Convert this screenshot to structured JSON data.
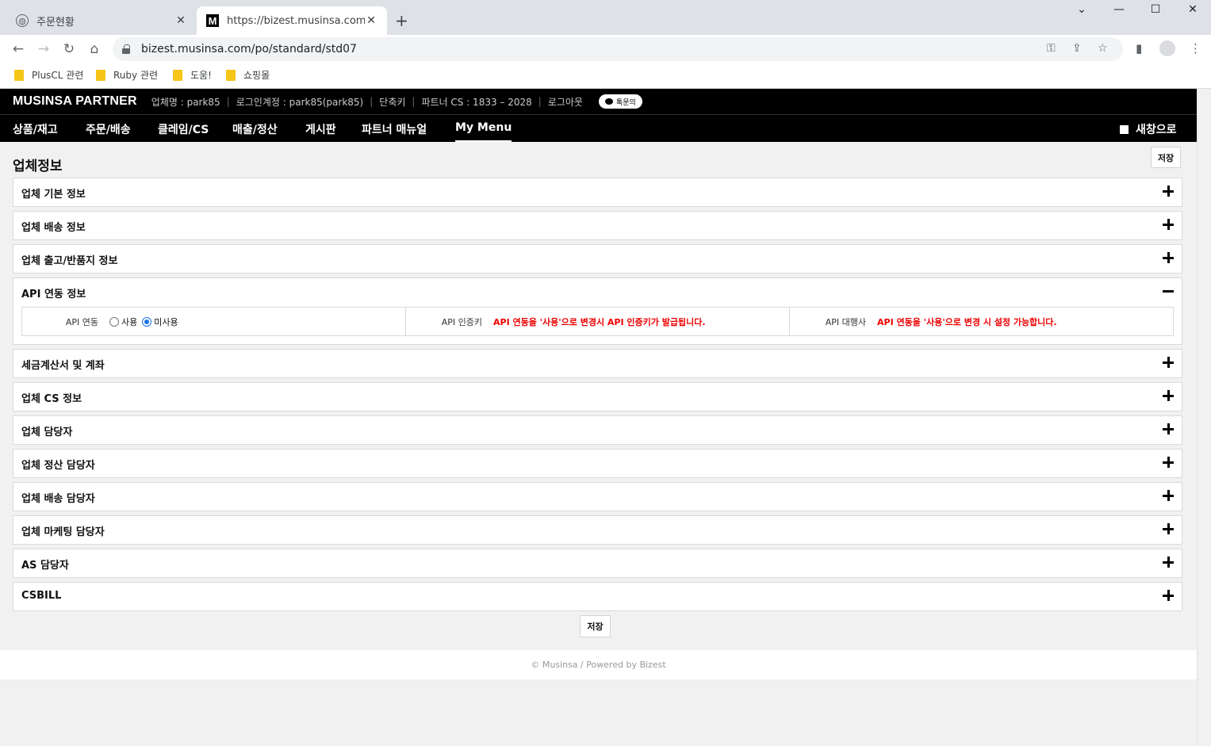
{
  "browser": {
    "tabs": [
      {
        "title": "주문현황"
      },
      {
        "title": "https://bizest.musinsa.com/po/s"
      }
    ],
    "url": "bizest.musinsa.com/po/standard/std07",
    "bookmarks": [
      "PlusCL 관련",
      "Ruby 관련",
      "도움!",
      "쇼핑몰"
    ]
  },
  "header": {
    "brand": "MUSINSA PARTNER",
    "company": "업체명 : park85",
    "login": "로그인계정 : park85(park85)",
    "shortcut": "단축키",
    "partner_cs": "파트너 CS : 1833 – 2028",
    "logout": "로그아웃",
    "talk": "톡문의"
  },
  "nav": {
    "items": [
      "상품/재고",
      "주문/배송",
      "클레임/CS",
      "매출/정산",
      "게시판",
      "파트너 매뉴얼",
      "My Menu"
    ],
    "new_window": "새창으로"
  },
  "page": {
    "title": "업체정보",
    "save_label": "저장",
    "panels": [
      "업체 기본 정보",
      "업체 배송 정보",
      "업체 출고/반품지 정보",
      "API 연동 정보",
      "세금계산서 및 계좌",
      "업체 CS 정보",
      "업체 담당자",
      "업체 정산 담당자",
      "업체 배송 담당자",
      "업체 마케팅 담당자",
      "AS 담당자",
      "CSBILL"
    ],
    "api": {
      "link_label": "API 연동",
      "option_use": "사용",
      "option_nouse": "미사용",
      "selected": "미사용",
      "key_label": "API 인증키",
      "key_notice": "API 연동을 '사용'으로 변경시 API 인증키가 발급됩니다.",
      "agency_label": "API 대행사",
      "agency_notice": "API 연동을 '사용'으로 변경 시 설정 가능합니다."
    }
  },
  "footer": "© Musinsa / Powered by Bizest",
  "colors": {
    "accent_red": "#ee0000",
    "header_bg": "#000000",
    "radio_blue": "#1a73e8"
  }
}
